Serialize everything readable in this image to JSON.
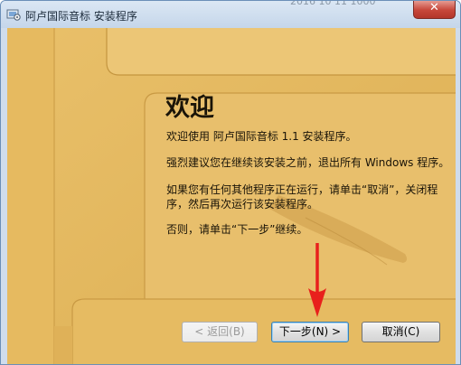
{
  "window": {
    "title": "阿卢国际音标 安装程序",
    "background_window_text": "2016 10 11 1000"
  },
  "titlebar": {
    "close_glyph": "✕"
  },
  "content": {
    "heading": "欢迎",
    "paragraphs": [
      "欢迎使用 阿卢国际音标 1.1 安装程序。",
      "强烈建议您在继续该安装之前，退出所有 Windows 程序。",
      "如果您有任何其他程序正在运行，请单击“取消”，关闭程",
      "序，然后再次运行该安装程序。",
      "否则，请单击“下一步”继续。"
    ]
  },
  "buttons": {
    "back_label": "< 返回(B)",
    "next_label": "下一步(N) >",
    "cancel_label": "取消(C)"
  },
  "icons": {
    "app": "installer-icon",
    "close": "close-icon",
    "pointer": "red-arrow-icon"
  },
  "colors": {
    "panel_background": "#e2b65a",
    "annotation_arrow": "#e8201c",
    "close_button": "#c7473b"
  }
}
